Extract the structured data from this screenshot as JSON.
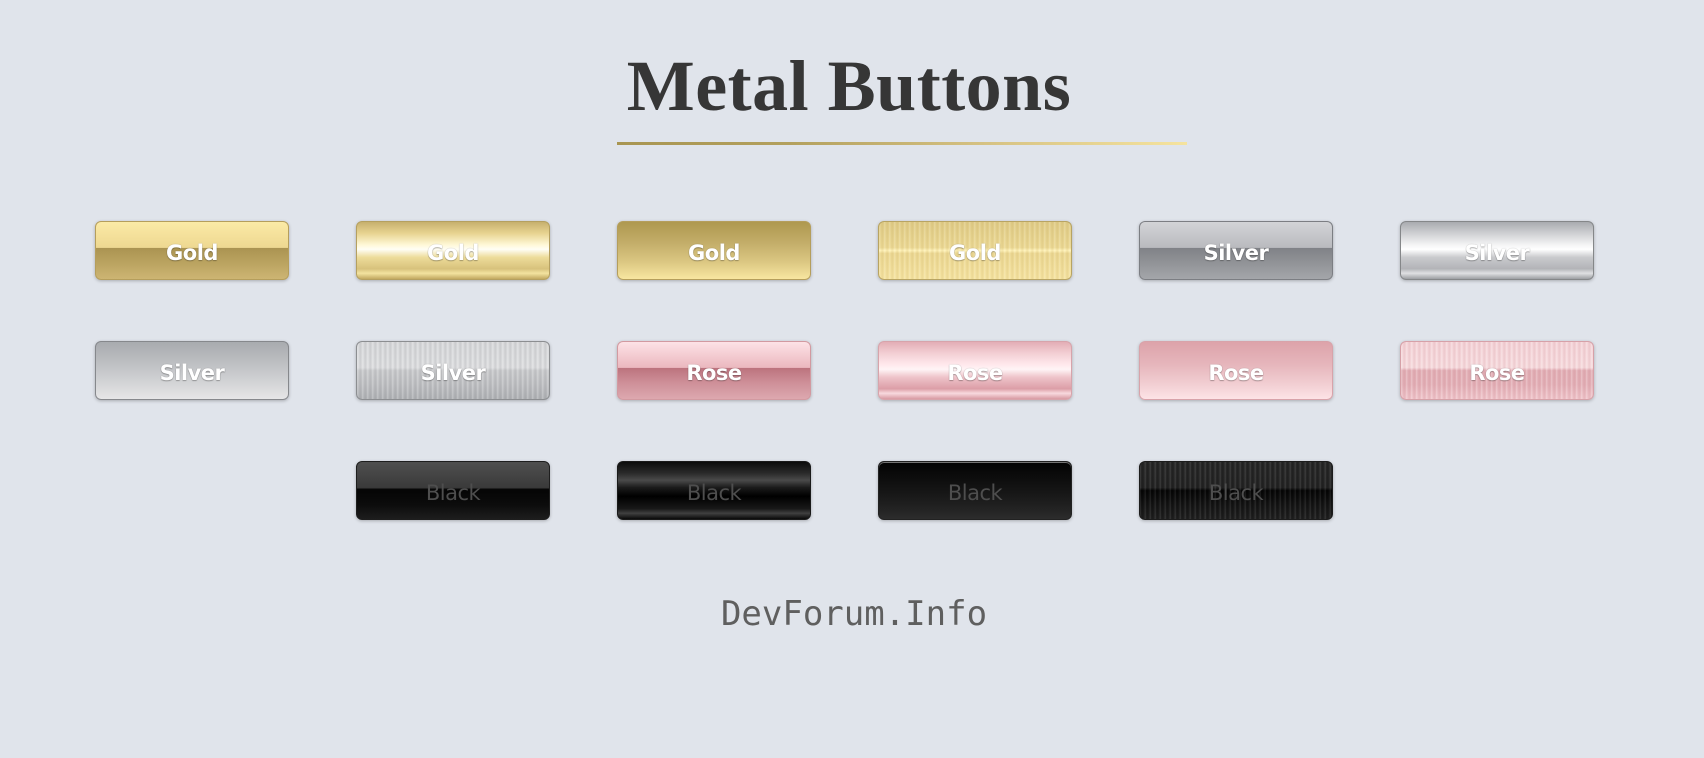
{
  "page": {
    "title": "Metal Buttons",
    "footer": "DevForum.Info"
  },
  "colors": {
    "background": "#e0e4eb",
    "title": "#363636",
    "underline_start": "#a89551",
    "underline_end": "#f5e39e",
    "footer": "#5f5f5f"
  },
  "buttons": [
    {
      "label": "Gold",
      "metal": "gold",
      "style": "classic"
    },
    {
      "label": "Gold",
      "metal": "gold",
      "style": "polished"
    },
    {
      "label": "Gold",
      "metal": "gold",
      "style": "gradient"
    },
    {
      "label": "Gold",
      "metal": "gold",
      "style": "brushed"
    },
    {
      "label": "Silver",
      "metal": "silver",
      "style": "classic"
    },
    {
      "label": "Silver",
      "metal": "silver",
      "style": "polished"
    },
    {
      "label": "Silver",
      "metal": "silver",
      "style": "gradient"
    },
    {
      "label": "Silver",
      "metal": "silver",
      "style": "brushed"
    },
    {
      "label": "Rose",
      "metal": "rose",
      "style": "classic"
    },
    {
      "label": "Rose",
      "metal": "rose",
      "style": "polished"
    },
    {
      "label": "Rose",
      "metal": "rose",
      "style": "gradient"
    },
    {
      "label": "Rose",
      "metal": "rose",
      "style": "brushed"
    },
    {
      "label": "Black",
      "metal": "black",
      "style": "classic"
    },
    {
      "label": "Black",
      "metal": "black",
      "style": "polished"
    },
    {
      "label": "Black",
      "metal": "black",
      "style": "gradient"
    },
    {
      "label": "Black",
      "metal": "black",
      "style": "brushed"
    }
  ]
}
